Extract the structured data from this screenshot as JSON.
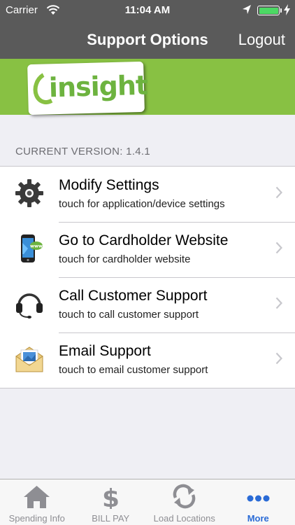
{
  "status": {
    "carrier": "Carrier",
    "time": "11:04 AM",
    "battery_level": 1.0
  },
  "nav": {
    "title": "Support Options",
    "logout_label": "Logout"
  },
  "banner": {
    "logo_text": "insight",
    "color": "#88c143"
  },
  "version_label": "CURRENT VERSION: 1.4.1",
  "rows": [
    {
      "title": "Modify Settings",
      "subtitle": "touch for application/device settings",
      "icon": "gear-icon"
    },
    {
      "title": "Go to Cardholder Website",
      "subtitle": "touch for cardholder website",
      "icon": "phone-web-icon"
    },
    {
      "title": "Call Customer Support",
      "subtitle": "touch to call customer support",
      "icon": "headset-icon"
    },
    {
      "title": "Email Support",
      "subtitle": "touch to email customer support",
      "icon": "envelope-icon"
    }
  ],
  "tabs": [
    {
      "label": "Spending Info",
      "icon": "house-icon",
      "active": false
    },
    {
      "label": "BILL PAY",
      "icon": "dollar-icon",
      "active": false
    },
    {
      "label": "Load Locations",
      "icon": "refresh-icon",
      "active": false
    },
    {
      "label": "More",
      "icon": "more-dots-icon",
      "active": true
    }
  ],
  "colors": {
    "nav_bg": "#5a5a5a",
    "accent_green": "#88c143",
    "active_tab": "#2a6bd6"
  }
}
